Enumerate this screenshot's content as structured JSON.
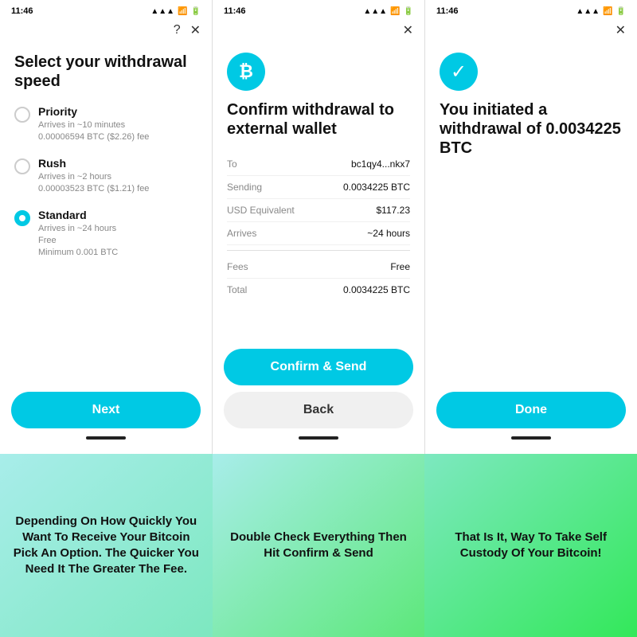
{
  "screens": [
    {
      "status_time": "11:46",
      "header_icons": [
        "?",
        "×"
      ],
      "title": "Select your withdrawal speed",
      "options": [
        {
          "name": "Priority",
          "desc_line1": "Arrives in ~10 minutes",
          "desc_line2": "0.00006594 BTC ($2.26) fee",
          "selected": false
        },
        {
          "name": "Rush",
          "desc_line1": "Arrives in ~2 hours",
          "desc_line2": "0.00003523 BTC ($1.21) fee",
          "selected": false
        },
        {
          "name": "Standard",
          "desc_line1": "Arrives in ~24 hours",
          "desc_line2": "Free",
          "desc_line3": "Minimum 0.001 BTC",
          "selected": true
        }
      ],
      "button_label": "Next"
    },
    {
      "status_time": "11:46",
      "header_icons": [
        "×"
      ],
      "btc_symbol": "₿",
      "title": "Confirm withdrawal to external wallet",
      "rows": [
        {
          "label": "To",
          "value": "bc1qy4...nkx7"
        },
        {
          "label": "Sending",
          "value": "0.0034225 BTC"
        },
        {
          "label": "USD Equivalent",
          "value": "$117.23"
        },
        {
          "label": "Arrives",
          "value": "~24 hours"
        }
      ],
      "rows2": [
        {
          "label": "Fees",
          "value": "Free"
        },
        {
          "label": "Total",
          "value": "0.0034225 BTC"
        }
      ],
      "primary_button": "Confirm & Send",
      "secondary_button": "Back"
    },
    {
      "status_time": "11:46",
      "header_icons": [
        "×"
      ],
      "check_symbol": "✓",
      "title": "You initiated a withdrawal of 0.0034225 BTC",
      "button_label": "Done"
    }
  ],
  "captions": [
    "Depending On How Quickly You Want To Receive Your Bitcoin Pick An Option. The Quicker You Need It The Greater The Fee.",
    "Double Check Everything Then Hit Confirm & Send",
    "That Is It, Way To Take Self Custody Of Your Bitcoin!"
  ]
}
